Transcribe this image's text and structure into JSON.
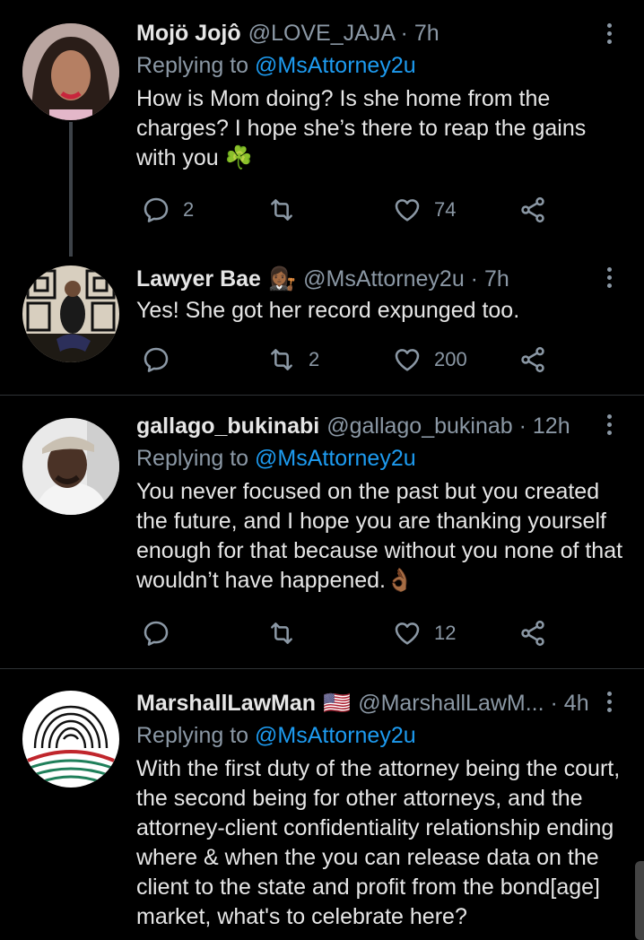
{
  "tweets": [
    {
      "name": "Mojö Jojô",
      "handle": "@LOVE_JAJA · 7h",
      "replying_prefix": "Replying to ",
      "replying_to": "@MsAttorney2u",
      "text": "How is Mom doing? Is she home from the charges? I hope she’s there to reap the gains with you",
      "emoji": "☘️",
      "replies": "2",
      "retweets": "",
      "likes": "74"
    },
    {
      "name": "Lawyer Bae",
      "badge": "👩🏾‍⚖️",
      "handle": "@MsAttorney2u · 7h",
      "text": "Yes! She got her record expunged too.",
      "replies": "",
      "retweets": "2",
      "likes": "200"
    },
    {
      "name": "gallago_bukinabi",
      "handle": "@gallago_bukinab · 12h",
      "replying_prefix": "Replying to ",
      "replying_to": "@MsAttorney2u",
      "text": "You never focused on the past but you created the future, and I hope you are thanking yourself enough for that because without you none of that wouldn’t have happened.",
      "emoji": "👌🏾",
      "replies": "",
      "retweets": "",
      "likes": "12"
    },
    {
      "name": "MarshallLawMan",
      "flag": "🇺🇸",
      "handle": "@MarshallLawM... · 4h",
      "replying_prefix": "Replying to ",
      "replying_to": "@MsAttorney2u",
      "text": "With the first duty of the attorney being the court, the second being for other attorneys, and the attorney-client confidentiality relationship ending where & when the you can release data on the client to the state and profit from the bond[age] market, what's to celebrate here?"
    }
  ],
  "colors": {
    "background": "#000000",
    "link": "#1d9bf0",
    "muted": "#8b98a5",
    "text": "#e6e6e6"
  }
}
